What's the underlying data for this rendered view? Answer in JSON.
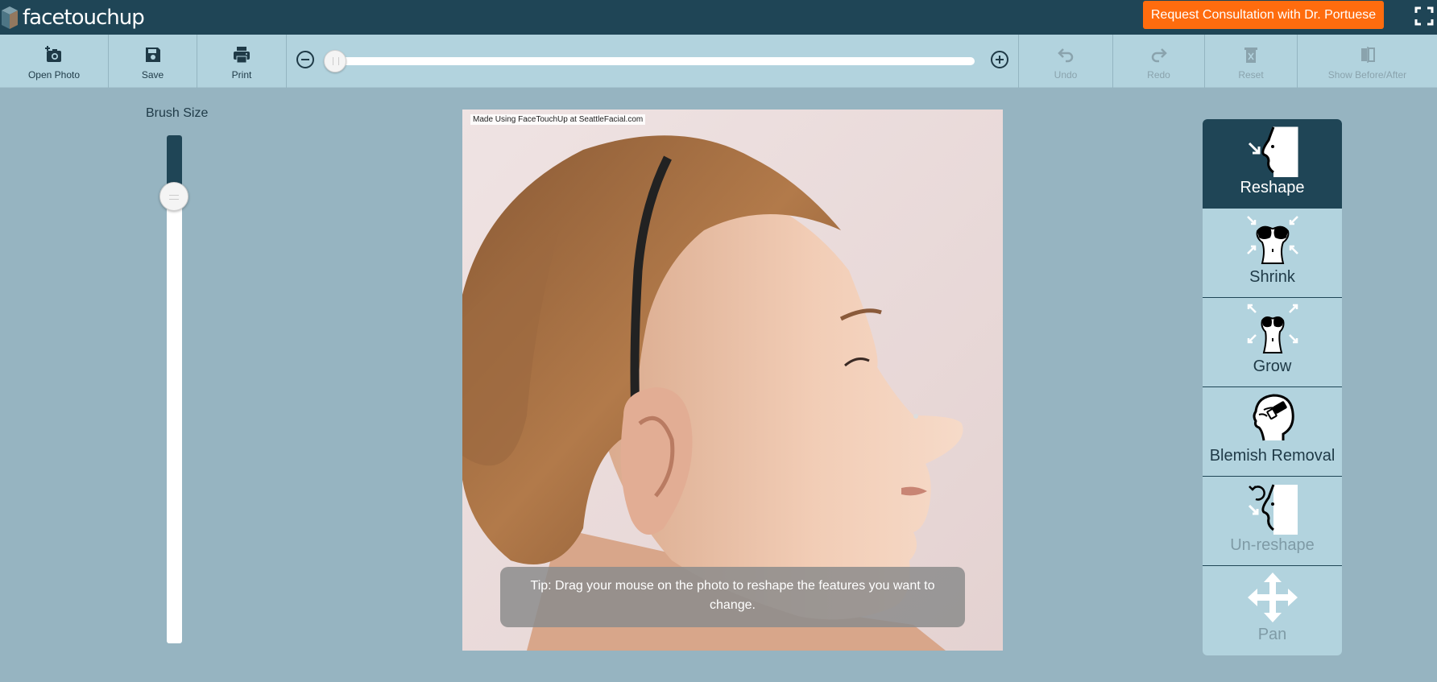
{
  "header": {
    "logo_text": "facetouchup",
    "consult_button": "Request Consultation with Dr. Portuese"
  },
  "toolbar": {
    "open_photo": "Open Photo",
    "save": "Save",
    "print": "Print",
    "zoom_level": 0,
    "undo": "Undo",
    "redo": "Redo",
    "reset": "Reset",
    "before_after": "Show Before/After"
  },
  "brush": {
    "label": "Brush Size",
    "value": 0.12
  },
  "canvas": {
    "watermark": "Made Using FaceTouchUp at SeattleFacial.com",
    "tip": "Tip: Drag your mouse on the photo to reshape the features you want to change."
  },
  "tools": [
    {
      "label": "Reshape",
      "icon": "reshape-icon",
      "state": "active"
    },
    {
      "label": "Shrink",
      "icon": "shrink-icon",
      "state": "normal"
    },
    {
      "label": "Grow",
      "icon": "grow-icon",
      "state": "normal"
    },
    {
      "label": "Blemish Removal",
      "icon": "blemish-removal-icon",
      "state": "normal"
    },
    {
      "label": "Un-reshape",
      "icon": "un-reshape-icon",
      "state": "dim"
    },
    {
      "label": "Pan",
      "icon": "pan-icon",
      "state": "dim"
    }
  ],
  "colors": {
    "topbar": "#1f4556",
    "toolbar": "#b2d3de",
    "background": "#96b4c1",
    "accent": "#ff6c0e"
  }
}
